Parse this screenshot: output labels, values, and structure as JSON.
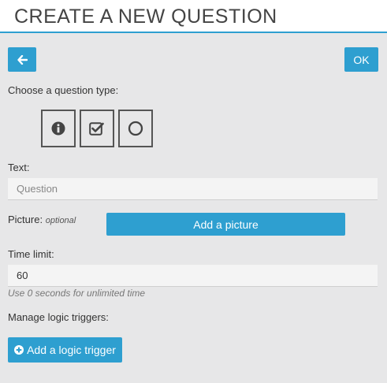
{
  "header": {
    "title": "CREATE A NEW QUESTION"
  },
  "toolbar": {
    "ok_label": "OK"
  },
  "question_type": {
    "label": "Choose a question type:",
    "types": [
      {
        "icon": "info-icon"
      },
      {
        "icon": "checkbox-icon"
      },
      {
        "icon": "radio-icon"
      }
    ]
  },
  "text_field": {
    "label": "Text:",
    "placeholder": "Question",
    "value": ""
  },
  "picture": {
    "label": "Picture:",
    "optional": "optional",
    "button_label": "Add a picture"
  },
  "time_limit": {
    "label": "Time limit:",
    "value": "60",
    "hint": "Use 0 seconds for unlimited time"
  },
  "logic": {
    "label": "Manage logic triggers:",
    "button_label": "Add a logic trigger"
  },
  "colors": {
    "accent": "#2e9fd0",
    "background": "#e7e7e8"
  }
}
